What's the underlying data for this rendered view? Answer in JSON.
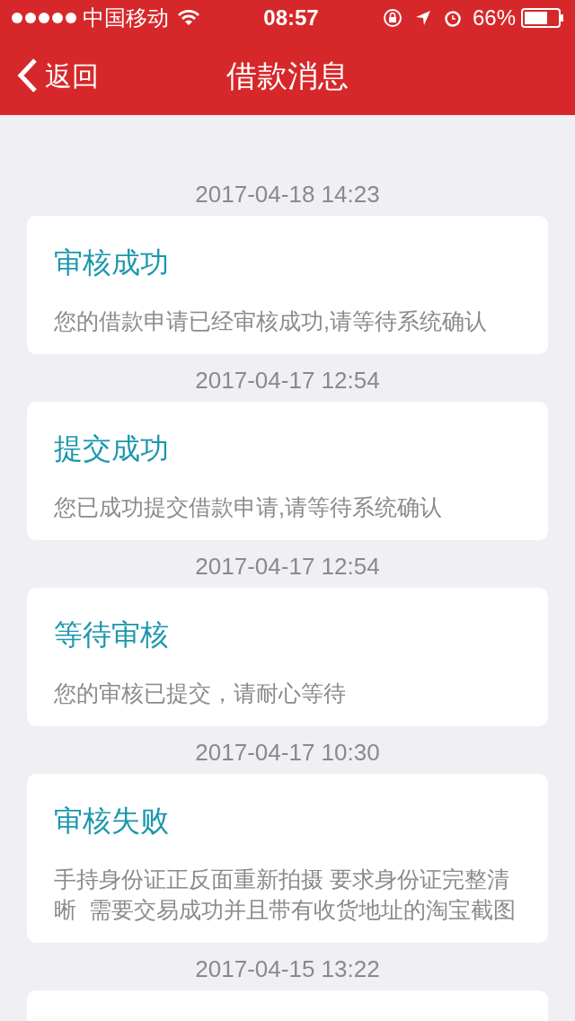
{
  "status_bar": {
    "carrier": "中国移动",
    "time": "08:57",
    "battery": "66%"
  },
  "nav": {
    "back": "返回",
    "title": "借款消息"
  },
  "messages": [
    {
      "time": "2017-04-18 14:23",
      "title": "审核成功",
      "body": "您的借款申请已经审核成功,请等待系统确认"
    },
    {
      "time": "2017-04-17 12:54",
      "title": "提交成功",
      "body": "您已成功提交借款申请,请等待系统确认"
    },
    {
      "time": "2017-04-17 12:54",
      "title": "等待审核",
      "body": "您的审核已提交，请耐心等待"
    },
    {
      "time": "2017-04-17 10:30",
      "title": "审核失败",
      "body": "手持身份证正反面重新拍摄 要求身份证完整清晰  需要交易成功并且带有收货地址的淘宝截图"
    },
    {
      "time": "2017-04-15 13:22"
    }
  ]
}
